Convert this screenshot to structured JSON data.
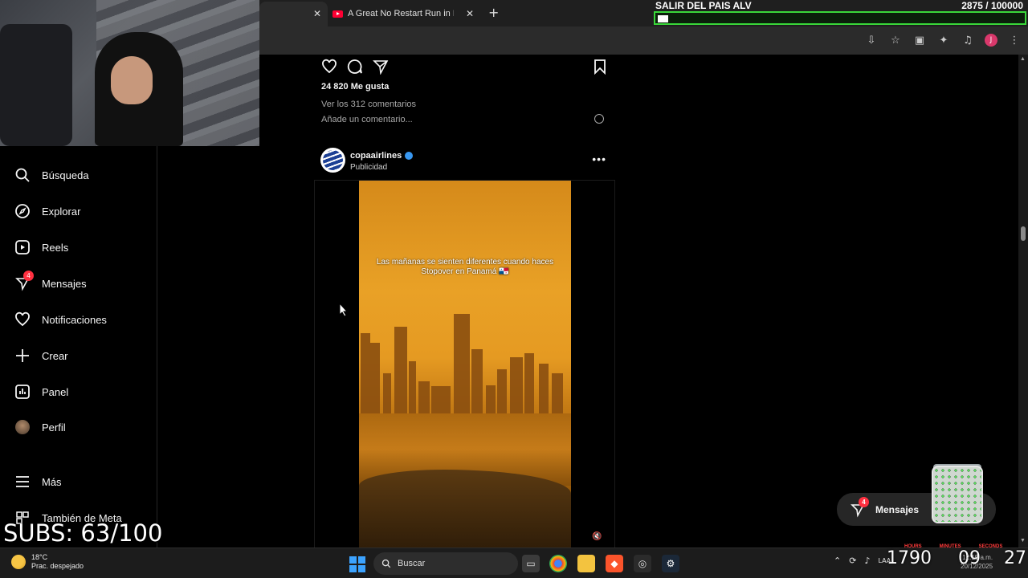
{
  "browser": {
    "tab2_title": "A Great No Restart Run in Dirt",
    "close_glyph": "✕",
    "newtab_glyph": "+"
  },
  "stream_goal": {
    "title": "SALIR DEL PAIS ALV",
    "count": "2875  / 100000",
    "progress": 0.0288
  },
  "subs": "SUBS: 63/100",
  "sidebar": {
    "items": [
      {
        "label": "Búsqueda",
        "icon": "search-icon"
      },
      {
        "label": "Explorar",
        "icon": "compass-icon"
      },
      {
        "label": "Reels",
        "icon": "reels-icon"
      },
      {
        "label": "Mensajes",
        "icon": "messenger-icon",
        "badge": "4"
      },
      {
        "label": "Notificaciones",
        "icon": "heart-icon"
      },
      {
        "label": "Crear",
        "icon": "plus-icon"
      },
      {
        "label": "Panel",
        "icon": "chart-icon"
      },
      {
        "label": "Perfil",
        "icon": "avatar"
      },
      {
        "label": "Más",
        "icon": "menu-icon"
      },
      {
        "label": "También de Meta",
        "icon": "meta-icon"
      }
    ]
  },
  "post1": {
    "likes": "24 820 Me gusta",
    "view_comments": "Ver los 312 comentarios",
    "add_comment_placeholder": "Añade un comentario..."
  },
  "post2": {
    "username": "copaairlines",
    "sponsored": "Publicidad",
    "more": "•••",
    "caption": "Las mañanas se sienten diferentes cuando haces Stopover en Panamá 🇵🇦",
    "mute_glyph": "🔇"
  },
  "messages_pill": {
    "label": "Mensajes",
    "badge": "4"
  },
  "taskbar": {
    "temperature": "18°C",
    "weather_desc": "Prac. despejado",
    "search_label": "Buscar",
    "timer": {
      "hours": "1790",
      "minutes": "09",
      "seconds": "27"
    },
    "timer_labels": [
      "HOURS",
      "MINUTES",
      "SECONDS"
    ],
    "time": "12:19 a.m.",
    "date": "20/12/2025",
    "lang": "LAA"
  },
  "colors": {
    "goal_border": "#3ad83a",
    "badge": "#ff3040",
    "verified": "#3897f0"
  }
}
